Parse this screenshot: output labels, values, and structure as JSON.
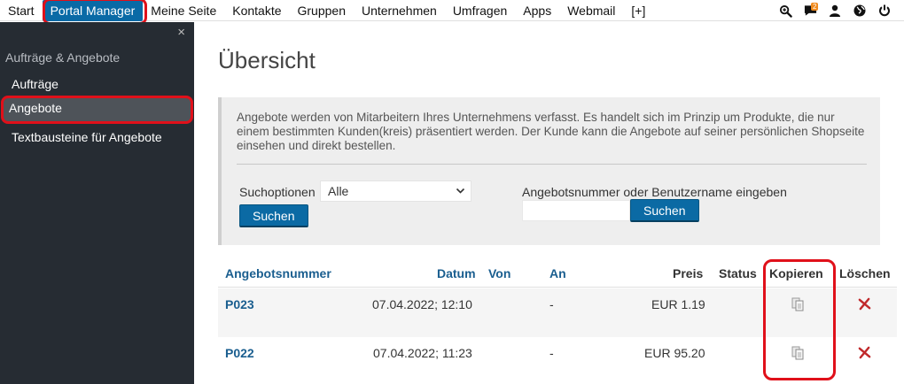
{
  "nav": {
    "items": [
      {
        "label": "Start"
      },
      {
        "label": "Portal Manager",
        "active": true
      },
      {
        "label": "Meine Seite"
      },
      {
        "label": "Kontakte"
      },
      {
        "label": "Gruppen"
      },
      {
        "label": "Unternehmen"
      },
      {
        "label": "Umfragen"
      },
      {
        "label": "Apps"
      },
      {
        "label": "Webmail"
      },
      {
        "label": "[+]"
      }
    ],
    "icons": [
      "search-zoom-icon",
      "chat-icon",
      "user-icon",
      "globe-icon",
      "power-icon"
    ],
    "chat_badge": "2"
  },
  "sidebar": {
    "close": "×",
    "section": "Aufträge & Angebote",
    "items": [
      {
        "label": "Aufträge"
      },
      {
        "label": "Angebote",
        "active": true
      },
      {
        "label": "Textbausteine für Angebote"
      }
    ]
  },
  "main": {
    "title": "Übersicht",
    "info": "Angebote werden von Mitarbeitern Ihres Unternehmens verfasst. Es handelt sich im Prinzip um Produkte, die nur einem bestimmten Kunden(kreis) präsentiert werden. Der Kunde kann die Angebote auf seiner persönlichen Shopseite einsehen und direkt bestellen.",
    "search": {
      "options_label": "Suchoptionen",
      "options_value": "Alle",
      "button1": "Suchen",
      "number_label": "Angebotsnummer oder Benutzername eingeben",
      "number_value": "",
      "button2": "Suchen"
    }
  },
  "table": {
    "headers": {
      "nummer": "Angebotsnummer",
      "datum": "Datum",
      "von": "Von",
      "an": "An",
      "preis": "Preis",
      "status": "Status",
      "kopieren": "Kopieren",
      "loeschen": "Löschen"
    },
    "rows": [
      {
        "nummer": "P023",
        "datum": "07.04.2022; 12:10",
        "von": "",
        "an": "-",
        "preis": "EUR 1.19",
        "status": ""
      },
      {
        "nummer": "P022",
        "datum": "07.04.2022; 11:23",
        "von": "",
        "an": "-",
        "preis": "EUR 95.20",
        "status": ""
      }
    ]
  },
  "colors": {
    "accent": "#0b6aa4",
    "sidebar_bg": "#262c33",
    "highlight": "#e0101a",
    "link": "#1a5e8f",
    "badge": "#f08a1d",
    "delete": "#c0282a"
  }
}
